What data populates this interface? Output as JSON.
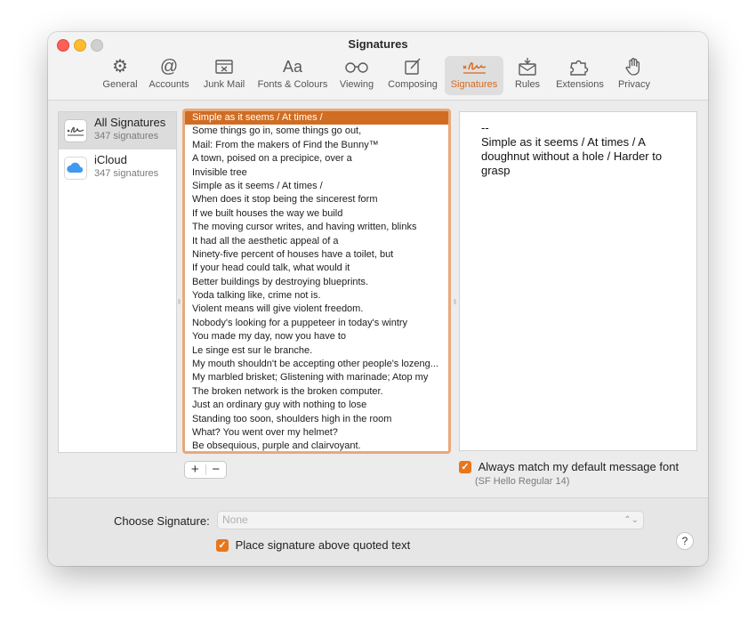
{
  "window": {
    "title": "Signatures"
  },
  "toolbar": {
    "items": [
      {
        "label": "General",
        "icon": "gear-icon"
      },
      {
        "label": "Accounts",
        "icon": "at-sign-icon"
      },
      {
        "label": "Junk Mail",
        "icon": "junk-tray-icon"
      },
      {
        "label": "Fonts & Colours",
        "icon": "font-aa-icon"
      },
      {
        "label": "Viewing",
        "icon": "glasses-icon"
      },
      {
        "label": "Composing",
        "icon": "compose-icon"
      },
      {
        "label": "Signatures",
        "icon": "signature-icon"
      },
      {
        "label": "Rules",
        "icon": "rules-envelope-icon"
      },
      {
        "label": "Extensions",
        "icon": "puzzle-icon"
      },
      {
        "label": "Privacy",
        "icon": "hand-icon"
      }
    ],
    "active": "Signatures",
    "glyphs": {
      "general": "⚙",
      "accounts": "@",
      "fonts": "Aa"
    }
  },
  "accounts": [
    {
      "name": "All Signatures",
      "count": "347 signatures",
      "selected": true
    },
    {
      "name": "iCloud",
      "count": "347 signatures",
      "selected": false
    }
  ],
  "signatures": [
    "Simple as it seems / At times /",
    "Some things go in, some things go out,",
    "Mail: From the makers of Find the Bunny™",
    "A town, poised on a precipice, over a",
    "Invisible tree",
    "Simple as it seems / At times /",
    "When does it stop being the sincerest form",
    "If we built houses the way we build",
    "The moving cursor writes, and having written, blinks",
    "It had all the aesthetic appeal of a",
    "Ninety-five percent of houses have a toilet, but",
    "If your head could talk, what would it",
    "Better buildings by destroying blueprints.",
    "Yoda talking like, crime not is.",
    "Violent means will give violent freedom.",
    "Nobody's looking for a puppeteer in today's wintry",
    "You made my day, now you have to",
    "Le singe est sur le branche.",
    "My mouth shouldn't be accepting other people's lozeng...",
    "My marbled brisket; Glistening with marinade; Atop my",
    "The broken network is the broken computer.",
    "Just an ordinary guy with nothing to lose",
    "Standing too soon, shoulders high in the room",
    "What? You went over my helmet?",
    "Be obsequious, purple and clairvoyant."
  ],
  "preview": {
    "separator": "--",
    "text": "Simple as it seems / At times / A doughnut without a hole / Harder to grasp"
  },
  "controls": {
    "add_label": "+",
    "remove_label": "−",
    "always_match_label": "Always match my default message font",
    "always_match_checked": true,
    "font_note": "(SF Hello Regular 14)",
    "checkmark": "✓"
  },
  "bottom": {
    "choose_label": "Choose Signature:",
    "choose_value": "None",
    "chevron": "⌃⌄",
    "place_label": "Place signature above quoted text",
    "place_checked": true,
    "help_label": "?"
  },
  "colors": {
    "accent": "#e8761b",
    "selection": "#d06d23",
    "list_focus_ring": "#e8a97a"
  }
}
